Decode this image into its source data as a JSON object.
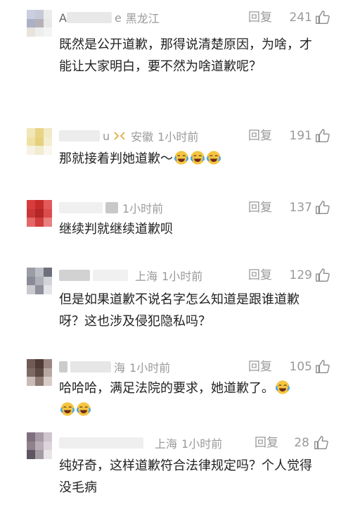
{
  "comments": [
    {
      "name_fragment": "A",
      "name_tail": "e",
      "location": "黑龙江",
      "time": "",
      "reply_label": "回复",
      "likes": "241",
      "text": "既然是公开道歉，那得说清楚原因，为啥，才能让大家明白，要不然为啥道歉呢？",
      "emojis": 0,
      "vip": false,
      "avatar_colors": [
        "#c9cfe0",
        "#c7c9d8",
        "#ececec",
        "#a9b1c7",
        "#b6b1b8",
        "#e8e8e8",
        "#e8e3dc",
        "#eeeeee",
        "#f4f4f4"
      ]
    },
    {
      "name_fragment": "",
      "name_tail": "u",
      "location": "安徽",
      "time": "1小时前",
      "reply_label": "回复",
      "likes": "191",
      "text": "那就接着判她道歉～",
      "emojis": 3,
      "vip": true,
      "avatar_colors": [
        "#f1e7b8",
        "#e9d486",
        "#f3e9c4",
        "#efe1a4",
        "#e5d17c",
        "#f5edcf",
        "#f7f3e4",
        "#f2ebd0",
        "#faf7ee"
      ]
    },
    {
      "name_fragment": "",
      "name_tail": "",
      "location": "",
      "time": "1小时前",
      "reply_label": "回复",
      "likes": "137",
      "text": "继续判就继续道歉呗",
      "emojis": 0,
      "vip": false,
      "avatar_colors": [
        "#d83c3c",
        "#c42c2c",
        "#e35a5a",
        "#c93636",
        "#b52626",
        "#dc4c4c",
        "#e36767",
        "#cf3d3d",
        "#e98080"
      ]
    },
    {
      "name_fragment": "",
      "name_tail": "",
      "location": "上海",
      "time": "1小时前",
      "reply_label": "回复",
      "likes": "129",
      "text": "但是如果道歉不说名字怎么知道是跟谁道歉呀？这也涉及侵犯隐私吗？",
      "emojis": 0,
      "vip": false,
      "avatar_colors": [
        "#9a9ca6",
        "#bcbcc4",
        "#6d6f7c",
        "#8a8b96",
        "#aeb0b8",
        "#d2d3d8",
        "#c9c9cf",
        "#8f909a",
        "#e4e4e8"
      ]
    },
    {
      "name_fragment": "",
      "name_tail": "海",
      "location": "",
      "time": "1小时前",
      "reply_label": "回复",
      "likes": "105",
      "text": "哈哈哈，满足法院的要求，她道歉了。",
      "emojis": 3,
      "vip": false,
      "avatar_colors": [
        "#6f5a54",
        "#4f3c37",
        "#9a8680",
        "#7e6a64",
        "#5d4943",
        "#b8a8a2",
        "#c9bcb6",
        "#8d7a74",
        "#d7ccc8"
      ]
    },
    {
      "name_fragment": "",
      "name_tail": "",
      "location": "上海",
      "time": "1小时前",
      "reply_label": "回复",
      "likes": "28",
      "text": "纯好奇，这样道歉符合法律规定吗？个人觉得没毛病",
      "emojis": 0,
      "vip": false,
      "avatar_colors": [
        "#7d6f7c",
        "#a79aa6",
        "#cfc6cd",
        "#8f828d",
        "#b9adb7",
        "#dcd4da",
        "#5e5562",
        "#a49aa3",
        "#e9e4e8"
      ]
    }
  ],
  "icons": {
    "like": "thumbs-up-icon",
    "emoji": "laughing-tears-emoji-icon"
  },
  "colors": {
    "meta": "#9a9a9a",
    "text": "#222222",
    "emoji": "#f5c542",
    "tear": "#4aa3e8"
  }
}
